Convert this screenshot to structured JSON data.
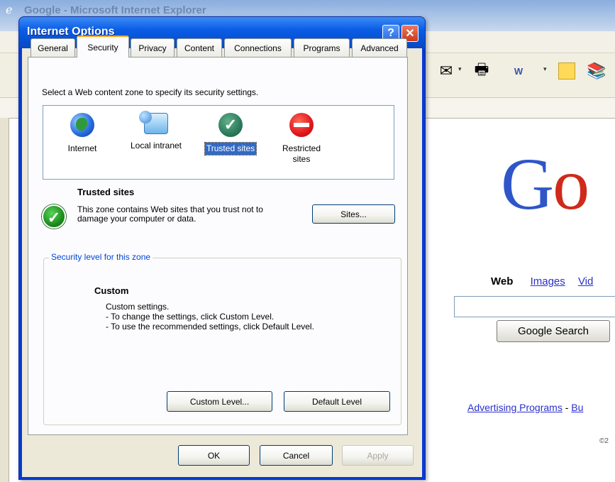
{
  "browser": {
    "title": "Google - Microsoft Internet Explorer",
    "google": {
      "logo": [
        "G",
        "o"
      ],
      "nav": {
        "web": "Web",
        "images": "Images",
        "video": "Vid"
      },
      "search_button": "Google Search",
      "footer_link1": "Advertising Programs",
      "footer_sep": " - ",
      "footer_link2": "Bu",
      "copyright": "©2"
    }
  },
  "dialog": {
    "title": "Internet Options",
    "help_label": "?",
    "close_label": "✕",
    "tabs": [
      {
        "label": "General"
      },
      {
        "label": "Security"
      },
      {
        "label": "Privacy"
      },
      {
        "label": "Content"
      },
      {
        "label": "Connections"
      },
      {
        "label": "Programs"
      },
      {
        "label": "Advanced"
      }
    ],
    "active_tab": "Security",
    "zone_instruction": "Select a Web content zone to specify its security settings.",
    "zones": [
      {
        "label": "Internet",
        "icon": "globe-icon"
      },
      {
        "label": "Local intranet",
        "icon": "intranet-icon"
      },
      {
        "label": "Trusted sites",
        "icon": "trusted-check-icon",
        "selected": true
      },
      {
        "label": "Restricted\nsites",
        "icon": "restricted-icon"
      }
    ],
    "zone_title": "Trusted sites",
    "zone_description": "This zone contains Web sites that you trust not to damage your computer or data.",
    "sites_button": "Sites...",
    "security_group_label": "Security level for this zone",
    "level_title": "Custom",
    "level_lines": [
      "Custom settings.",
      "- To change the settings, click Custom Level.",
      "- To use the recommended settings, click Default Level."
    ],
    "custom_level_button": "Custom Level...",
    "default_level_button": "Default Level",
    "ok_button": "OK",
    "cancel_button": "Cancel",
    "apply_button": "Apply",
    "check_glyph": "✓"
  }
}
